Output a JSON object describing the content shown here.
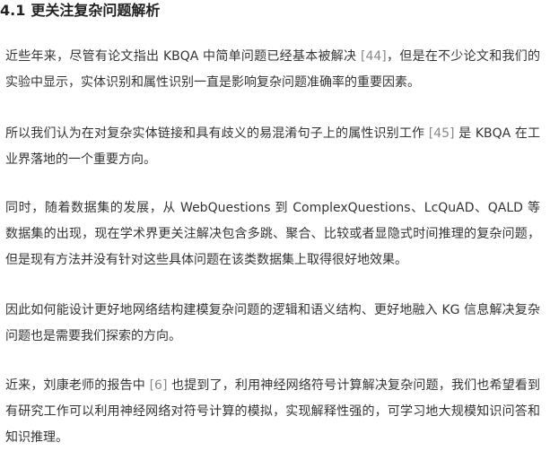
{
  "heading": {
    "number": "4.1",
    "title": "更关注复杂问题解析"
  },
  "paragraphs": [
    {
      "before": "近些年来，尽管有论文指出 KBQA 中简单问题已经基本被解决 ",
      "cite": "[44]",
      "after": "，但是在不少论文和我们的实验中显示，实体识别和属性识别一直是影响复杂问题准确率的重要因素。"
    },
    {
      "before": "所以我们认为在对复杂实体链接和具有歧义的易混淆句子上的属性识别工作 ",
      "cite": "[45]",
      "after": " 是 KBQA 在工业界落地的一个重要方向。"
    },
    {
      "text": "同时，随着数据集的发展，从 WebQuestions 到 ComplexQuestions、LcQuAD、QALD 等数据集的出现，现在学术界更关注解决包含多跳、聚合、比较或者显隐式时间推理的复杂问题，但是现有方法并没有针对这些具体问题在该类数据集上取得很好地效果。"
    },
    {
      "text": "因此如何能设计更好地网络结构建模复杂问题的逻辑和语义结构、更好地融入 KG 信息解决复杂问题也是需要我们探索的方向。"
    },
    {
      "before": "近来，刘康老师的报告中 ",
      "cite": "[6]",
      "after": " 也提到了，利用神经网络符号计算解决复杂问题，我们也希望看到有研究工作可以利用神经网络对符号计算的模拟，实现解释性强的，可学习地大规模知识问答和知识推理。"
    }
  ]
}
